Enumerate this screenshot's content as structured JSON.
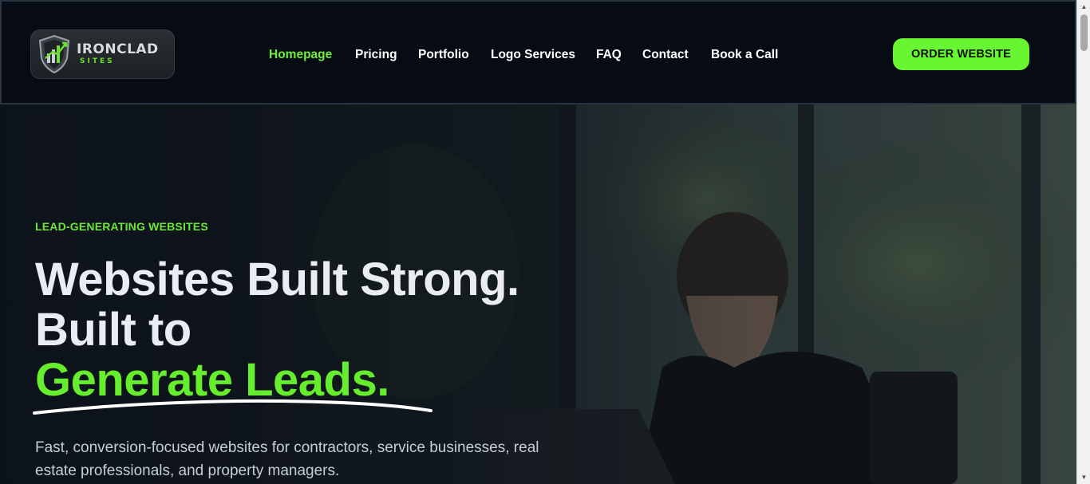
{
  "brand": {
    "logo_main": "IRONCLAD",
    "logo_sub": "SITES",
    "accent_color": "#66ee2e"
  },
  "nav": {
    "items": [
      {
        "label": "Homepage",
        "active": true
      },
      {
        "label": "Pricing",
        "active": false
      },
      {
        "label": "Portfolio",
        "active": false
      },
      {
        "label": "Logo Services",
        "active": false
      },
      {
        "label": "FAQ",
        "active": false
      },
      {
        "label": "Contact",
        "active": false
      },
      {
        "label": "Book a Call",
        "active": false
      }
    ],
    "cta_label": "ORDER WEBSITE"
  },
  "hero": {
    "eyebrow": "LEAD-GENERATING WEBSITES",
    "headline_line1": "Websites Built Strong.",
    "headline_line2": "Built to",
    "headline_accent": "Generate Leads.",
    "subtext": "Fast, conversion-focused websites for contractors, service businesses, real estate professionals, and property managers."
  },
  "icons": {
    "logo": "shield-logo-icon",
    "scroll_up": "scroll-up-arrow-icon",
    "scroll_down": "scroll-down-arrow-icon"
  }
}
